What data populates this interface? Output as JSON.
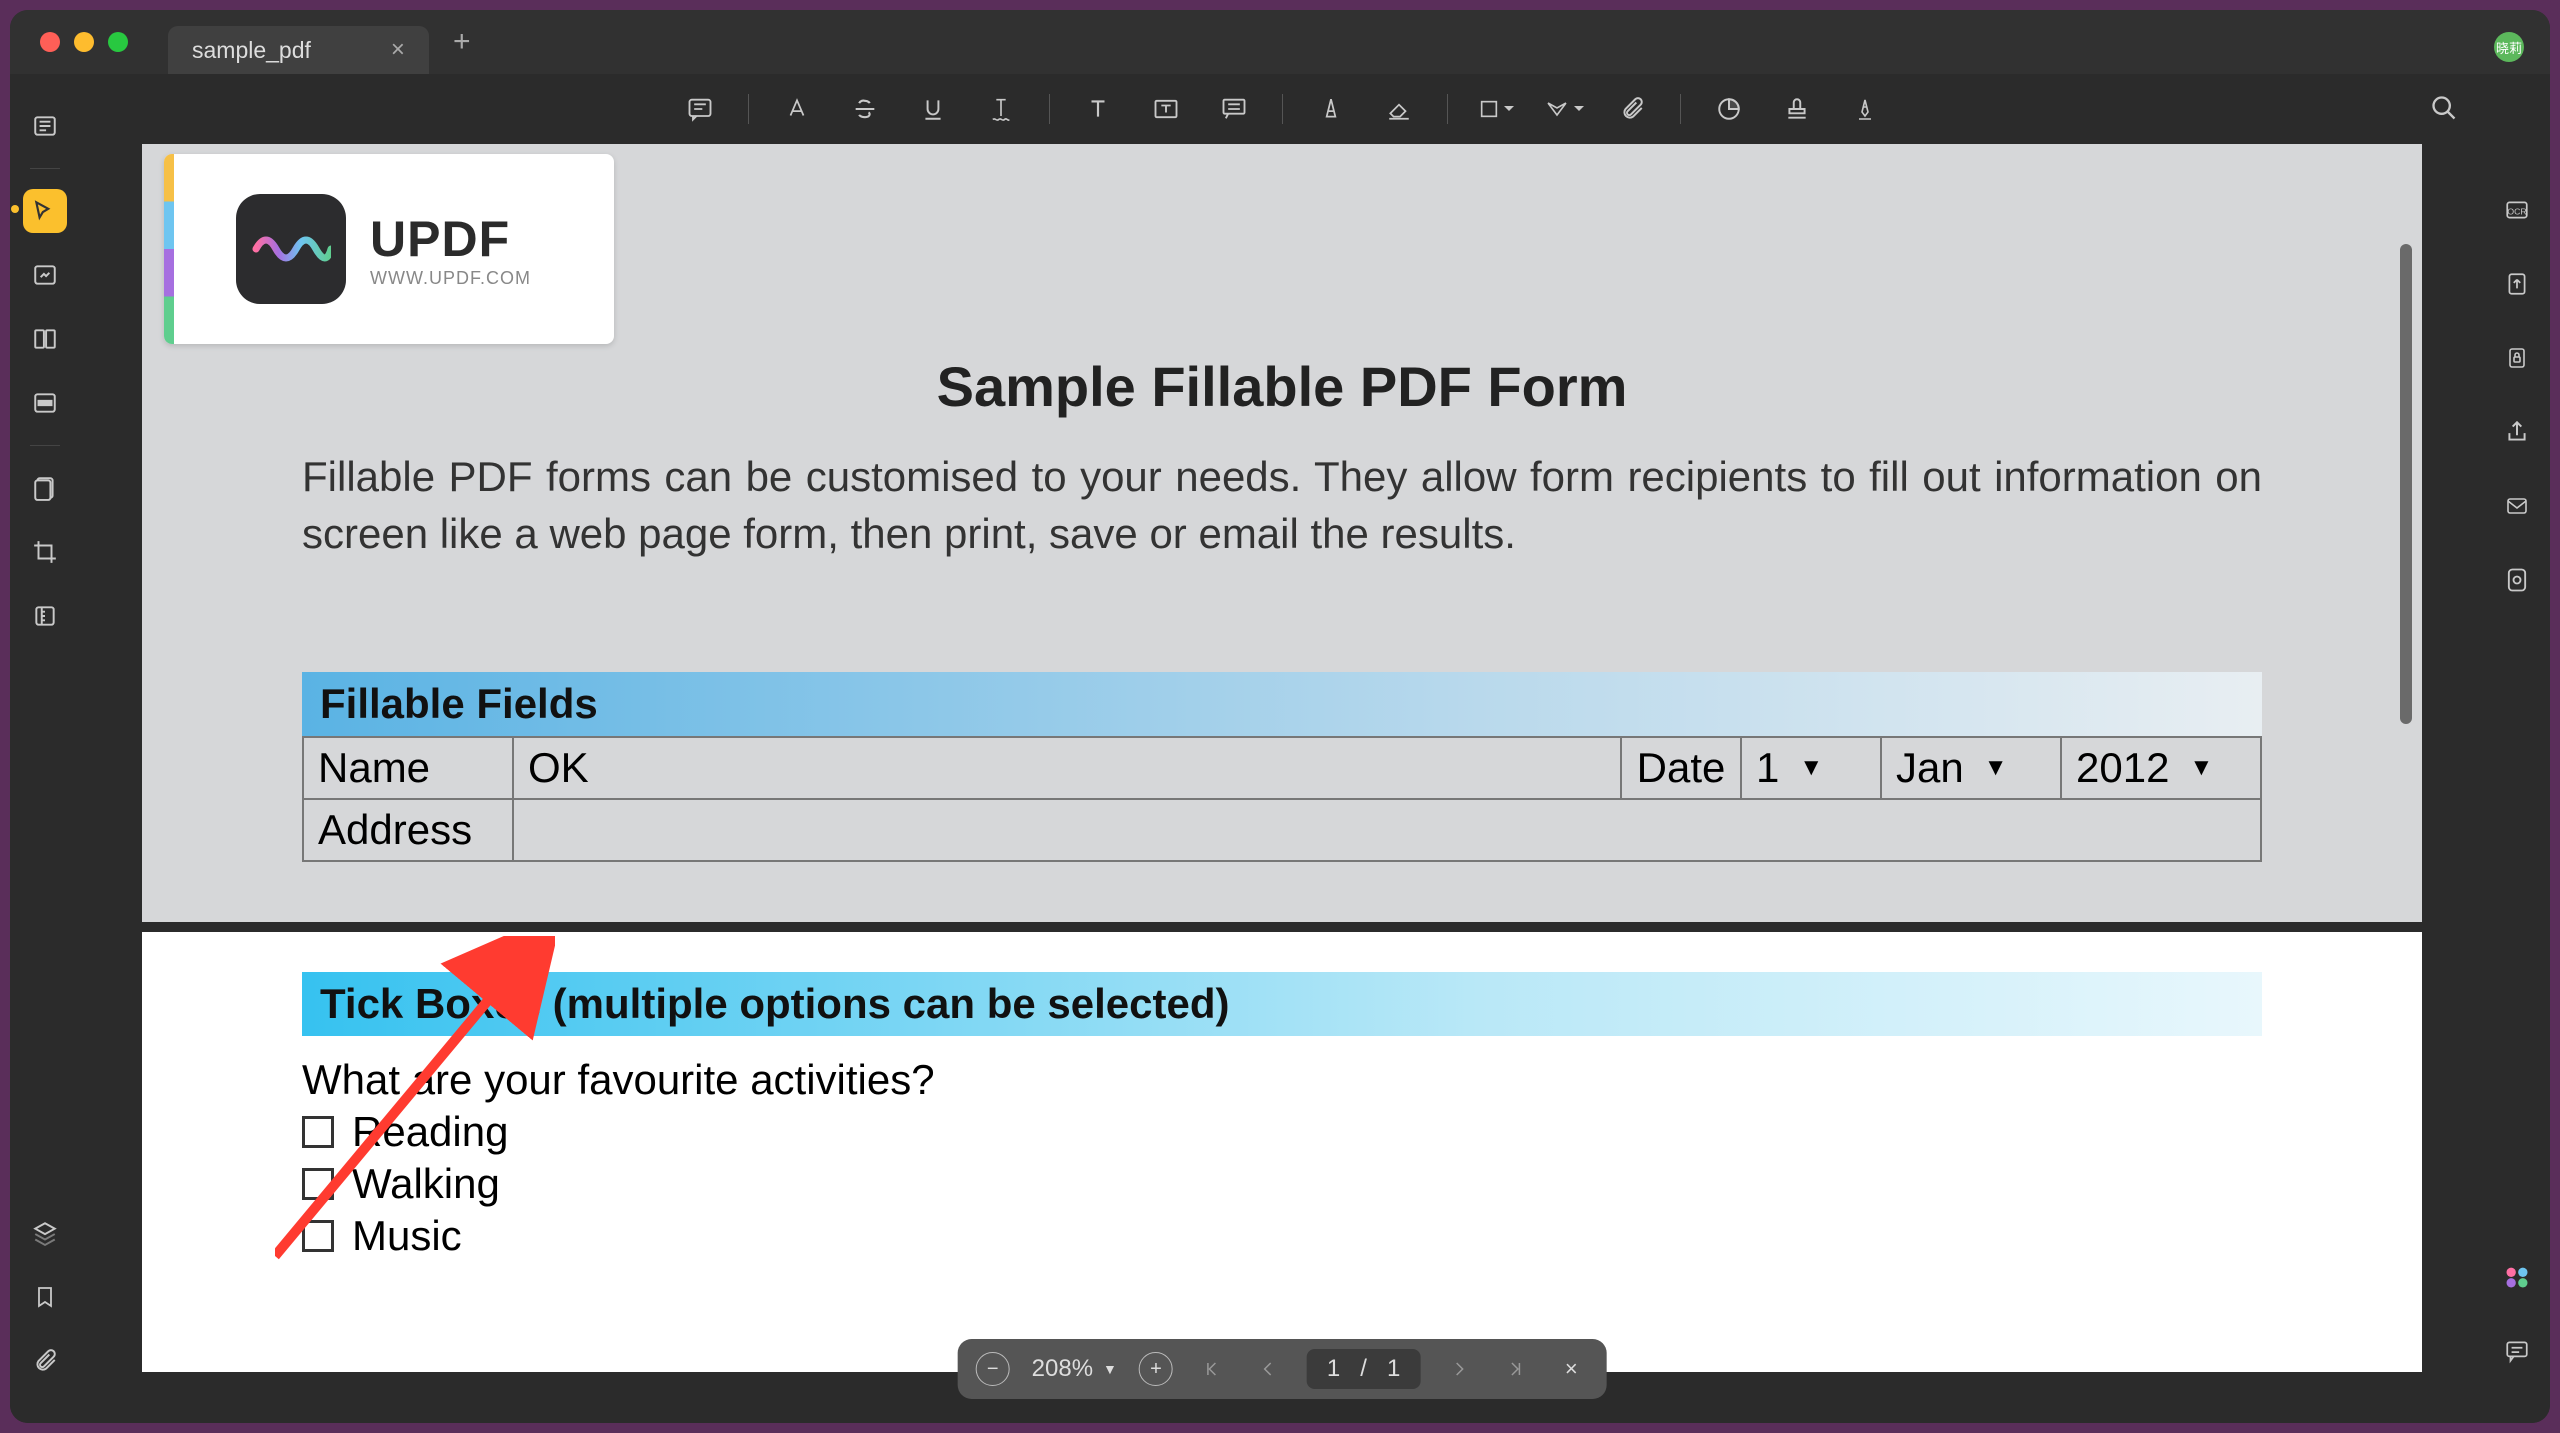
{
  "tab": {
    "title": "sample_pdf"
  },
  "avatar_label": "晓莉",
  "doc": {
    "brand": "UPDF",
    "brand_site": "WWW.UPDF.COM",
    "title": "Sample Fillable PDF Form",
    "intro": "Fillable PDF forms can be customised to your needs. They allow form recipients to fill out information on screen like a web page form, then print, save or email the results.",
    "section_fields": "Fillable Fields",
    "labels": {
      "name": "Name",
      "address": "Address",
      "date": "Date"
    },
    "name_value": "OK",
    "address_value": "",
    "date": {
      "day": "1",
      "month": "Jan",
      "year": "2012"
    },
    "section_tick": "Tick Boxes (multiple options can be selected)",
    "tick_q": "What are your favourite activities?",
    "tick_opts": [
      "Reading",
      "Walking",
      "Music"
    ]
  },
  "footer": {
    "zoom": "208%",
    "page_current": "1",
    "page_sep": "/",
    "page_total": "1"
  }
}
